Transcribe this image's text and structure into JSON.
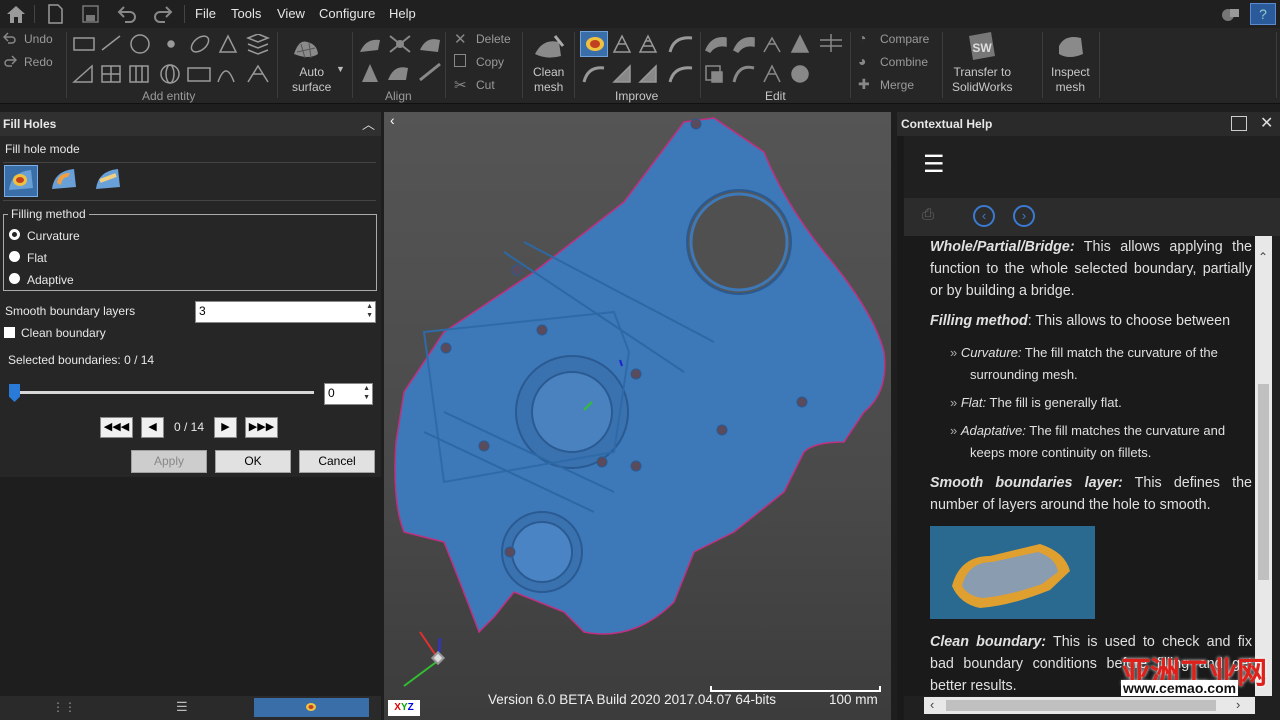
{
  "menubar": {
    "items": [
      "File",
      "Tools",
      "View",
      "Configure",
      "Help"
    ]
  },
  "ribbon": {
    "undo": "Undo",
    "redo": "Redo",
    "add_entity": "Add entity",
    "auto_surface": [
      "Auto",
      "surface"
    ],
    "align": "Align",
    "delete": "Delete",
    "copy": "Copy",
    "cut": "Cut",
    "clean_mesh": [
      "Clean",
      "mesh"
    ],
    "improve": "Improve",
    "edit": "Edit",
    "compare": "Compare",
    "combine": "Combine",
    "merge": "Merge",
    "transfer": [
      "Transfer to",
      "SolidWorks"
    ],
    "inspect": [
      "Inspect",
      "mesh"
    ]
  },
  "fill_holes": {
    "title": "Fill Holes",
    "mode_label": "Fill hole mode",
    "filling_method": "Filling method",
    "methods": [
      "Curvature",
      "Flat",
      "Adaptive"
    ],
    "selected_method": "Curvature",
    "smooth_label": "Smooth boundary layers",
    "smooth_value": "3",
    "clean_label": "Clean boundary",
    "selected_boundaries": "Selected boundaries: 0 / 14",
    "slider_value": "0",
    "slider_fraction": 0,
    "nav_counter": "0 / 14",
    "apply": "Apply",
    "ok": "OK",
    "cancel": "Cancel"
  },
  "viewport": {
    "version": "Version 6.0 BETA Build 2020 2017.04.07 64-bits",
    "scale": "100 mm",
    "axes": [
      "X",
      "Y",
      "Z"
    ],
    "mesh_color": "#3d78b8"
  },
  "help": {
    "title": "Contextual Help",
    "p1_b": "Whole/Partial/Bridge:",
    "p1": " This allows applying the function to the whole selected boundary, partially or by building a bridge.",
    "p2_b": "Filling method",
    "p2": ": This allows to choose between",
    "li1_i": "Curvature:",
    "li1": " The fill match the curvature of the surrounding mesh.",
    "li2_i": "Flat:",
    "li2": " The fill is generally flat.",
    "li3_i": "Adaptative:",
    "li3": " The fill matches the curvature and keeps more continuity on fillets.",
    "p3_b": "Smooth boundaries layer:",
    "p3": " This defines the number of layers around the hole to smooth.",
    "p4_b": "Clean boundary:",
    "p4": " This is used to check and fix bad boundary conditions before filling and get better results."
  },
  "watermark": {
    "cn": "亚洲工业网",
    "url": "www.cemao.com"
  }
}
